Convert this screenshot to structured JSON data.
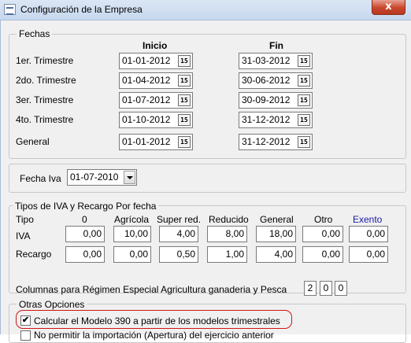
{
  "window": {
    "title": "Configuración de la Empresa",
    "close_label": "x"
  },
  "fechas": {
    "legend": "Fechas",
    "col_inicio": "Inicio",
    "col_fin": "Fin",
    "rows": [
      {
        "label": "1er. Trimestre",
        "inicio": "01-01-2012",
        "fin": "31-03-2012"
      },
      {
        "label": "2do. Trimestre",
        "inicio": "01-04-2012",
        "fin": "30-06-2012"
      },
      {
        "label": "3er. Trimestre",
        "inicio": "01-07-2012",
        "fin": "30-09-2012"
      },
      {
        "label": "4to. Trimestre",
        "inicio": "01-10-2012",
        "fin": "31-12-2012"
      },
      {
        "label": "General",
        "inicio": "01-01-2012",
        "fin": "31-12-2012"
      }
    ],
    "calendar_icon_text": "15"
  },
  "fecha_iva": {
    "label": "Fecha Iva",
    "value": "01-07-2010"
  },
  "tipos": {
    "legend": "Tipos de IVA y Recargo Por fecha",
    "headers": [
      "Tipo",
      "0",
      "Agrícola",
      "Super red.",
      "Reducido",
      "General",
      "Otro",
      "Exento"
    ],
    "exento_color": "#1a1aa6",
    "iva": {
      "label": "IVA",
      "values": [
        "0,00",
        "10,00",
        "4,00",
        "8,00",
        "18,00",
        "0,00",
        "0,00"
      ]
    },
    "recargo": {
      "label": "Recargo",
      "values": [
        "0,00",
        "0,00",
        "0,50",
        "1,00",
        "4,00",
        "0,00",
        "0,00"
      ]
    }
  },
  "columnas": {
    "label": "Columnas para Régimen Especial Agricultura ganaderia y Pesca",
    "values": [
      "2",
      "0",
      "0"
    ]
  },
  "otras": {
    "legend": "Otras Opciones",
    "opt1": {
      "label": "Calcular el Modelo 390 a partir de los modelos trimestrales",
      "checked": true,
      "check_glyph": "✔"
    },
    "opt2": {
      "label": "No permitir la importación (Apertura) del ejercicio anterior"
    }
  }
}
